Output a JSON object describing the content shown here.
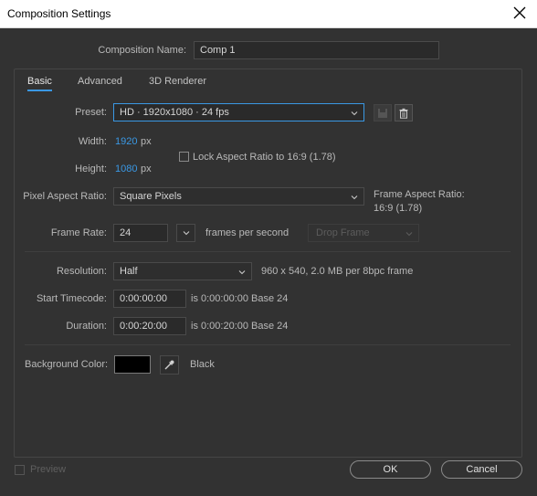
{
  "window": {
    "title": "Composition Settings"
  },
  "comp_name": {
    "label": "Composition Name:",
    "value": "Comp 1"
  },
  "tabs": [
    {
      "label": "Basic",
      "active": true
    },
    {
      "label": "Advanced",
      "active": false
    },
    {
      "label": "3D Renderer",
      "active": false
    }
  ],
  "preset": {
    "label": "Preset:",
    "value": "HD  ·  1920x1080 · 24 fps"
  },
  "width": {
    "label": "Width:",
    "value": "1920",
    "unit": "px"
  },
  "height": {
    "label": "Height:",
    "value": "1080",
    "unit": "px"
  },
  "lock_aspect": {
    "label": "Lock Aspect Ratio to 16:9 (1.78)",
    "checked": false
  },
  "pixel_aspect": {
    "label": "Pixel Aspect Ratio:",
    "value": "Square Pixels"
  },
  "frame_aspect": {
    "label": "Frame Aspect Ratio:",
    "value": "16:9 (1.78)"
  },
  "frame_rate": {
    "label": "Frame Rate:",
    "value": "24",
    "unit": "frames per second",
    "drop_frame": "Drop Frame"
  },
  "resolution": {
    "label": "Resolution:",
    "value": "Half",
    "info": "960 x 540, 2.0 MB per 8bpc frame"
  },
  "start_timecode": {
    "label": "Start Timecode:",
    "value": "0:00:00:00",
    "info": "is 0:00:00:00  Base 24"
  },
  "duration": {
    "label": "Duration:",
    "value": "0:00:20:00",
    "info": "is 0:00:20:00  Base 24"
  },
  "background_color": {
    "label": "Background Color:",
    "name": "Black",
    "swatch": "#000000"
  },
  "footer": {
    "preview_label": "Preview",
    "ok_label": "OK",
    "cancel_label": "Cancel"
  },
  "colors": {
    "accent": "#3a98e4",
    "dialog_bg": "#323232",
    "field_bg": "#2a2a2a"
  }
}
